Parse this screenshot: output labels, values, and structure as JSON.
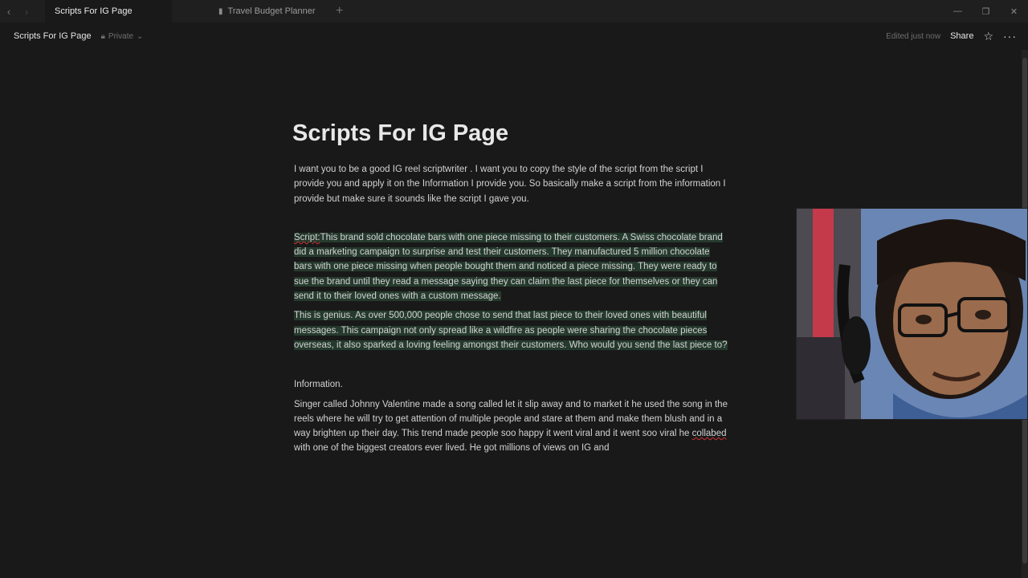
{
  "tabs": [
    {
      "label": "Scripts For IG Page",
      "active": true
    },
    {
      "label": "Travel Budget Planner",
      "active": false,
      "icon": "briefcase-icon"
    }
  ],
  "topbar": {
    "breadcrumb": "Scripts For IG Page",
    "privacy": "Private",
    "edited": "Edited just now",
    "share": "Share"
  },
  "page": {
    "title": "Scripts For IG Page",
    "intro": "I want you to be a good IG reel scriptwriter . I want you to copy the style of the script from the script I provide you and apply it on the Information I provide you. So basically make a script from the information I provide but make sure it sounds like the script I gave you.",
    "script_label": "Script:",
    "script_body": "This brand sold chocolate bars with one piece missing to their customers. A Swiss chocolate brand did a marketing campaign to surprise and test their customers. They manufactured 5 million chocolate bars with one piece missing when people bought them and noticed a piece missing. They were ready to sue the brand until they read a message saying they can claim the last piece for themselves or they can send it to their loved ones with a custom message.",
    "genius": "This is genius. As over 500,000 people chose to send that last piece to their loved ones with beautiful messages. This campaign not only spread like a wildfire as people were sharing the chocolate pieces overseas, it also sparked a loving feeling amongst their customers. Who would you send the last piece to?",
    "info_heading": "Information.",
    "info_before": "Singer called Johnny Valentine made a song called let it slip away and to market it he used the song in the reels where he will try to get attention of multiple people and stare at  them and make them blush and in a way brighten up their day. This trend made people soo happy it went viral and it went soo viral he ",
    "info_misspelled": "collabed",
    "info_after": " with one of the biggest creators ever lived. He got millions of views on IG and"
  }
}
